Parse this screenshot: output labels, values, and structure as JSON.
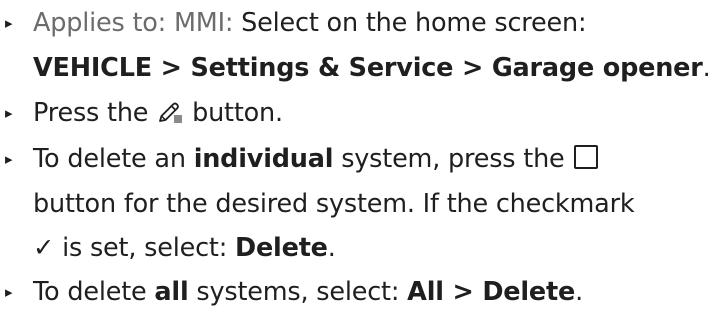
{
  "instructions": {
    "step1": {
      "prefix": "Applies to: MMI:",
      "text": " Select on the home screen:",
      "path": {
        "item1": "VEHICLE",
        "sep1": " > ",
        "item2": "Settings & Service",
        "sep2": " > ",
        "item3": "Garage opener",
        "end": "."
      }
    },
    "step2": {
      "before": "Press the ",
      "icon": "edit-icon",
      "after": " button."
    },
    "step3": {
      "before": "To delete an ",
      "bold": "individual",
      "after": " system, press the ",
      "icon": "checkbox-icon",
      "line2": "button for the desired system. If the checkmark",
      "check_glyph": "✓",
      "line3_mid": " is set, select: ",
      "delete": "Delete",
      "end": "."
    },
    "step4": {
      "before": "To delete ",
      "bold": "all",
      "mid": " systems, select: ",
      "all": "All",
      "sep": " > ",
      "delete": "Delete",
      "end": "."
    },
    "bullet_glyph": "▸"
  }
}
